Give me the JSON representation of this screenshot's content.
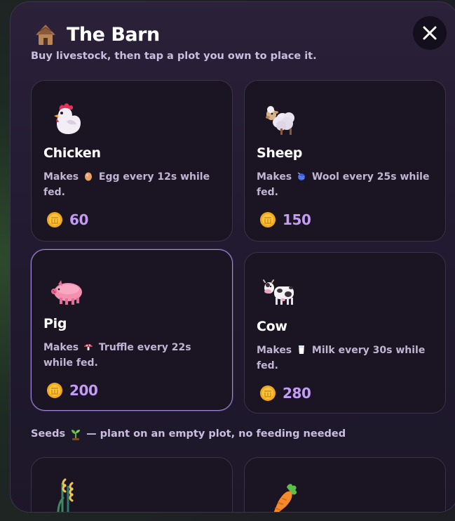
{
  "barn": {
    "title": "The Barn",
    "subtitle": "Buy livestock, then tap a plot you own to place it.",
    "close_icon": "close-icon",
    "accent_color": "#c29cf5"
  },
  "animals": [
    {
      "name": "Chicken",
      "desc_before": "Makes",
      "product_icon": "egg-icon",
      "desc_after": "Egg every 12s while fed.",
      "price": "60",
      "icon": "chicken-icon",
      "selected": false
    },
    {
      "name": "Sheep",
      "desc_before": "Makes",
      "product_icon": "yarn-icon",
      "desc_after": "Wool every 25s while fed.",
      "price": "150",
      "icon": "sheep-icon",
      "selected": false
    },
    {
      "name": "Pig",
      "desc_before": "Makes",
      "product_icon": "mushroom-icon",
      "desc_after": "Truffle every 22s while fed.",
      "price": "200",
      "icon": "pig-icon",
      "selected": true
    },
    {
      "name": "Cow",
      "desc_before": "Makes",
      "product_icon": "milk-icon",
      "desc_after": "Milk every 30s while fed.",
      "price": "280",
      "icon": "cow-icon",
      "selected": false
    }
  ],
  "seeds_section": {
    "label_before": "Seeds",
    "label_after": "— plant on an empty plot, no feeding needed",
    "icon": "sprout-icon"
  },
  "seeds": [
    {
      "icon": "wheat-icon"
    },
    {
      "icon": "carrot-icon"
    }
  ]
}
